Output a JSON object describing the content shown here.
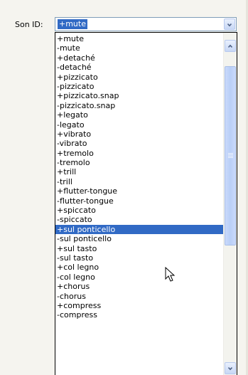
{
  "field": {
    "label": "Son ID:",
    "value": "+mute"
  },
  "dropdown": {
    "selected_index": 22,
    "items": [
      "+mute",
      "-mute",
      "+detaché",
      "-detaché",
      "+pizzicato",
      "-pizzicato",
      "+pizzicato.snap",
      "-pizzicato.snap",
      "+legato",
      "-legato",
      "+vibrato",
      "-vibrato",
      "+tremolo",
      "-tremolo",
      "+trill",
      "-trill",
      "+flutter-tongue",
      "-flutter-tongue",
      "+spiccato",
      "-spiccato",
      "+sul ponticello",
      "-sul ponticello",
      "+sul tasto",
      "-sul tasto",
      "+col legno",
      "-col legno",
      "+chorus",
      "-chorus",
      "+compress",
      "-compress"
    ]
  },
  "colors": {
    "selection": "#316ac5",
    "scroll_button": "#c7d7f5"
  },
  "icons": {
    "combo_arrow": "chevron-down-icon",
    "scroll_up": "chevron-up-icon",
    "scroll_down": "chevron-down-icon",
    "cursor": "mouse-pointer-icon"
  }
}
